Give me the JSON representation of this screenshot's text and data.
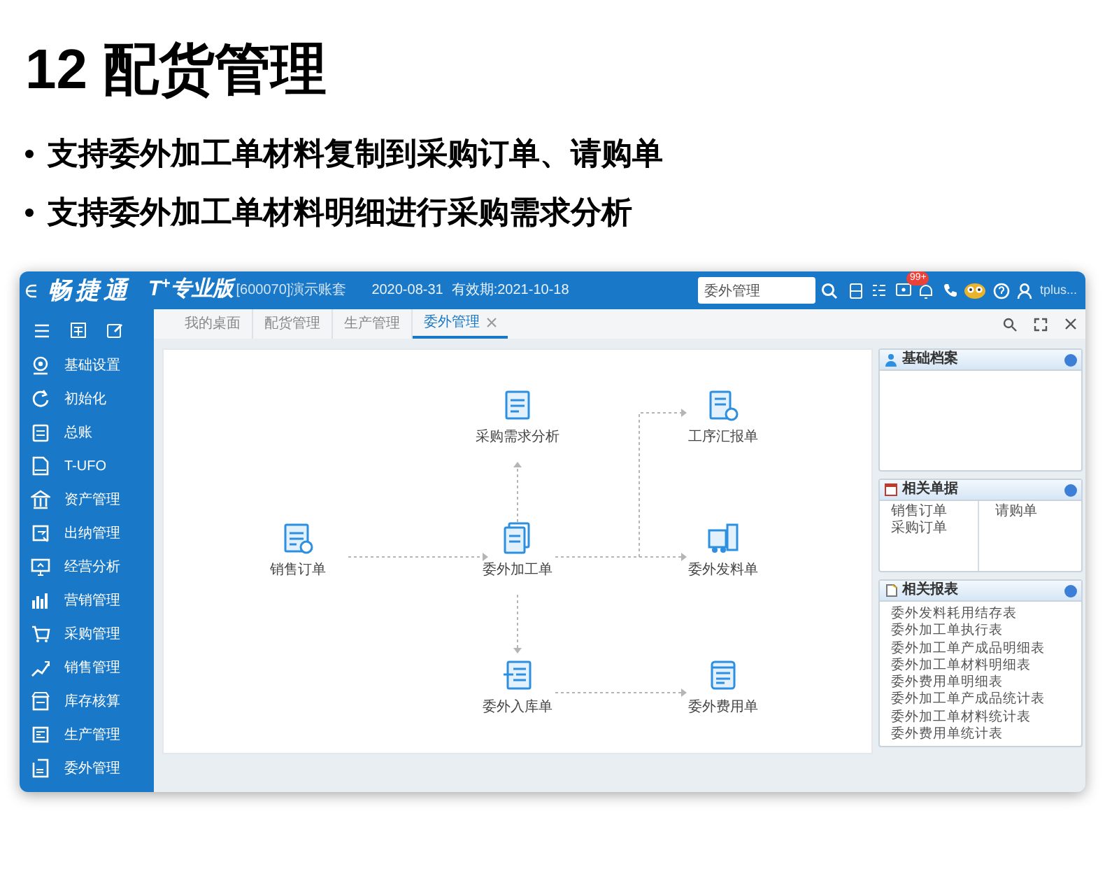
{
  "title": "12 配货管理",
  "bullets": [
    "支持委外加工单材料复制到采购订单、请购单",
    "支持委外加工单材料明细进行采购需求分析"
  ],
  "app": {
    "brand": "畅捷通",
    "edition": "T$^{+}$专业版",
    "account": "[600070]演示账套",
    "date": "2020-08-31",
    "validity": "有效期:2021-10-18",
    "search": {
      "value": "委外管理"
    },
    "badge": "99+",
    "user": "tplus..."
  },
  "sidebar": {
    "items": [
      "基础设置",
      "初始化",
      "总账",
      "T-UFO",
      "资产管理",
      "出纳管理",
      "经营分析",
      "营销管理",
      "采购管理",
      "销售管理",
      "库存核算",
      "生产管理",
      "委外管理"
    ]
  },
  "tabs": [
    {
      "label": "我的桌面",
      "selected": false
    },
    {
      "label": "配货管理",
      "selected": false
    },
    {
      "label": "生产管理",
      "selected": false
    },
    {
      "label": "委外管理",
      "selected": true
    }
  ],
  "flow": {
    "nodes": [
      "采购需求分析",
      "工序汇报单",
      "销售订单",
      "委外加工单",
      "委外发料单",
      "委外入库单",
      "委外费用单"
    ]
  },
  "panels": [
    {
      "title": "基础档案",
      "kind": "empty"
    },
    {
      "title": "相关单据",
      "kind": "columns",
      "columns": [
        [
          "销售订单",
          "采购订单"
        ],
        [
          "请购单"
        ]
      ]
    },
    {
      "title": "相关报表",
      "kind": "list",
      "items": [
        "委外发料耗用结存表",
        "委外加工单执行表",
        "委外加工单产成品明细表",
        "委外加工单材料明细表",
        "委外费用单明细表",
        "委外加工单产成品统计表",
        "委外加工单材料统计表",
        "委外费用单统计表"
      ]
    }
  ]
}
